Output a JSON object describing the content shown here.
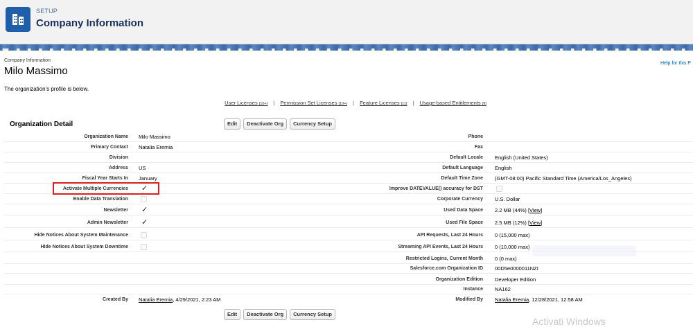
{
  "header": {
    "setup_label": "SETUP",
    "title": "Company Information"
  },
  "page": {
    "small_label": "Company Information",
    "title": "Milo Massimo",
    "help": "Help for this P",
    "intro": "The organization's profile is below."
  },
  "links": [
    {
      "label": "User Licenses",
      "count": "[10+]"
    },
    {
      "label": "Permission Set Licenses",
      "count": "[10+]"
    },
    {
      "label": "Feature Licenses",
      "count": "[11]"
    },
    {
      "label": "Usage-based Entitlements",
      "count": "[9]"
    }
  ],
  "section": {
    "title": "Organization Detail"
  },
  "buttons": {
    "edit": "Edit",
    "deactivate": "Deactivate Org",
    "currency": "Currency Setup"
  },
  "left_fields": [
    {
      "label": "Organization Name",
      "value": "Milo Massimo"
    },
    {
      "label": "Primary Contact",
      "value": "Natalia Eremia"
    },
    {
      "label": "Division",
      "value": ""
    },
    {
      "label": "Address",
      "value": "US"
    },
    {
      "label": "Fiscal Year Starts In",
      "value": "January"
    },
    {
      "label": "Activate Multiple Currencies",
      "value": "✓"
    },
    {
      "label": "Enable Data Translation",
      "value": ""
    },
    {
      "label": "Newsletter",
      "value": "✓"
    },
    {
      "label": "Admin Newsletter",
      "value": "✓"
    },
    {
      "label": "Hide Notices About System Maintenance",
      "value": ""
    },
    {
      "label": "Hide Notices About System Downtime",
      "value": ""
    }
  ],
  "right_fields": [
    {
      "label": "Phone",
      "value": ""
    },
    {
      "label": "Fax",
      "value": ""
    },
    {
      "label": "Default Locale",
      "value": "English (United States)"
    },
    {
      "label": "Default Language",
      "value": "English"
    },
    {
      "label": "Default Time Zone",
      "value": "(GMT-08:00) Pacific Standard Time (America/Los_Angeles)"
    },
    {
      "label": "Improve DATEVALUE() accuracy for DST",
      "value": ""
    },
    {
      "label": "Corporate Currency",
      "value": "U.S. Dollar"
    },
    {
      "label": "Used Data Space",
      "value": "2.2 MB (44%)",
      "link": "View"
    },
    {
      "label": "Used File Space",
      "value": "2.5 MB (12%)",
      "link": "View"
    },
    {
      "label": "API Requests, Last 24 Hours",
      "value": "0 (15,000 max)"
    },
    {
      "label": "Streaming API Events, Last 24 Hours",
      "value": "0 (10,000 max)"
    },
    {
      "label": "Restricted Logins, Current Month",
      "value": "0 (0 max)"
    },
    {
      "label": "Salesforce.com Organization ID",
      "value": "00D5e0000011NZI"
    },
    {
      "label": "Organization Edition",
      "value": "Developer Edition"
    },
    {
      "label": "Instance",
      "value": "NA162"
    }
  ],
  "created": {
    "label": "Created By",
    "user": "Natalia Eremia",
    "date": ", 4/29/2021, 2:23 AM"
  },
  "modified": {
    "label": "Modified By",
    "user": "Natalia Eremia",
    "date": ", 12/28/2021, 12:58 AM"
  },
  "watermark": "Activati Windows"
}
